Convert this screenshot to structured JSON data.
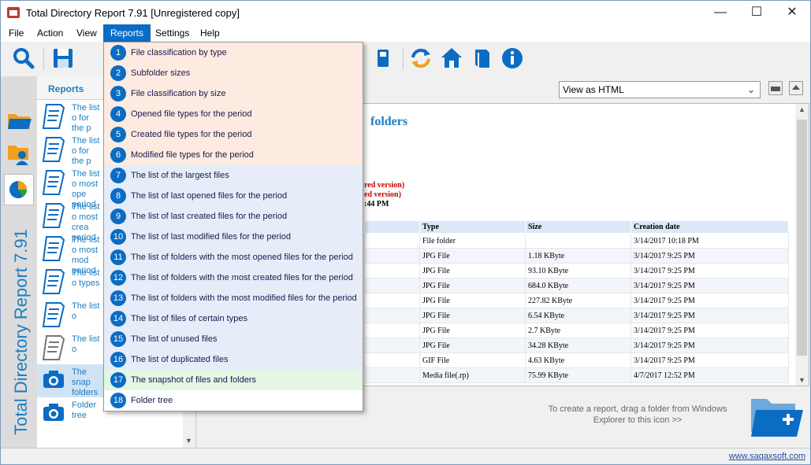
{
  "window": {
    "title": "Total Directory Report 7.91 [Unregistered copy]"
  },
  "window_controls": {
    "minimize": "—",
    "maximize": "☐",
    "close": "✕"
  },
  "menu": [
    "File",
    "Action",
    "View",
    "Reports",
    "Settings",
    "Help"
  ],
  "active_menu": "Reports",
  "toolbar_icons": [
    "search-icon",
    "save-icon",
    "usb-icon",
    "refresh-icon",
    "home-icon",
    "book-icon",
    "info-icon"
  ],
  "side_tab": {
    "label": "Total Directory Report  7.91"
  },
  "reports_panel": {
    "header": "Reports",
    "items": [
      {
        "text": "The list o for the p"
      },
      {
        "text": "The list o for the p"
      },
      {
        "text": "The list o most ope period"
      },
      {
        "text": "The list o most crea period"
      },
      {
        "text": "The list o most mod period"
      },
      {
        "text": "The list o types"
      },
      {
        "text": "The list o"
      },
      {
        "text": "The list o"
      },
      {
        "text": "The snap folders"
      },
      {
        "text": "Folder tree"
      }
    ]
  },
  "view_select": {
    "value": "View as HTML"
  },
  "document": {
    "title_fragment": "folders",
    "red_line_1": "red version)",
    "red_line_2": "ed version)",
    "time_line": ":44 PM",
    "table": {
      "headers": [
        "Type",
        "Size",
        "Creation date"
      ],
      "rows": [
        [
          "File folder",
          "",
          "3/14/2017 10:18 PM"
        ],
        [
          "JPG File",
          "1.18 KByte",
          "3/14/2017 9:25 PM"
        ],
        [
          "JPG File",
          "93.10 KByte",
          "3/14/2017 9:25 PM"
        ],
        [
          "JPG File",
          "684.0 KByte",
          "3/14/2017 9:25 PM"
        ],
        [
          "JPG File",
          "227.82 KByte",
          "3/14/2017 9:25 PM"
        ],
        [
          "JPG File",
          "6.54 KByte",
          "3/14/2017 9:25 PM"
        ],
        [
          "JPG File",
          "2.7 KByte",
          "3/14/2017 9:25 PM"
        ],
        [
          "JPG File",
          "34.28 KByte",
          "3/14/2017 9:25 PM"
        ],
        [
          "GIF File",
          "4.63 KByte",
          "3/14/2017 9:25 PM"
        ],
        [
          "Media file(.rp)",
          "75.99 KByte",
          "4/7/2017 12:52 PM"
        ]
      ]
    }
  },
  "hint": "To create a report, drag a folder from Windows Explorer to this icon >>",
  "status": {
    "link": "www.saqaxsoft.com"
  },
  "reports_menu": {
    "groups": [
      {
        "color": "#fdebe2",
        "items": [
          {
            "num": "1",
            "label": "File classification by type"
          },
          {
            "num": "2",
            "label": "Subfolder sizes"
          },
          {
            "num": "3",
            "label": "File classification by size"
          },
          {
            "num": "4",
            "label": "Opened file types for the period"
          },
          {
            "num": "5",
            "label": "Created file types for the period"
          },
          {
            "num": "6",
            "label": "Modified file types for the period"
          }
        ]
      },
      {
        "color": "#e6edf9",
        "items": [
          {
            "num": "7",
            "label": "The list of the largest files"
          },
          {
            "num": "8",
            "label": "The list of last opened files for the period"
          },
          {
            "num": "9",
            "label": "The list of last created files for the period"
          },
          {
            "num": "10",
            "label": "The list of last modified files for the period"
          },
          {
            "num": "11",
            "label": "The list of folders with the most opened files for the period"
          },
          {
            "num": "12",
            "label": "The list of folders with the most created files for the period"
          },
          {
            "num": "13",
            "label": "The list of folders with the most modified files for the period"
          },
          {
            "num": "14",
            "label": "The list of files of certain types"
          },
          {
            "num": "15",
            "label": "The list of unused files"
          },
          {
            "num": "16",
            "label": "The list of duplicated files"
          }
        ]
      },
      {
        "color": "#e4f6e4",
        "items": [
          {
            "num": "17",
            "label": "The snapshot of files and folders"
          }
        ]
      },
      {
        "color": "#ffffff",
        "items": [
          {
            "num": "18",
            "label": "Folder tree"
          }
        ]
      }
    ]
  }
}
